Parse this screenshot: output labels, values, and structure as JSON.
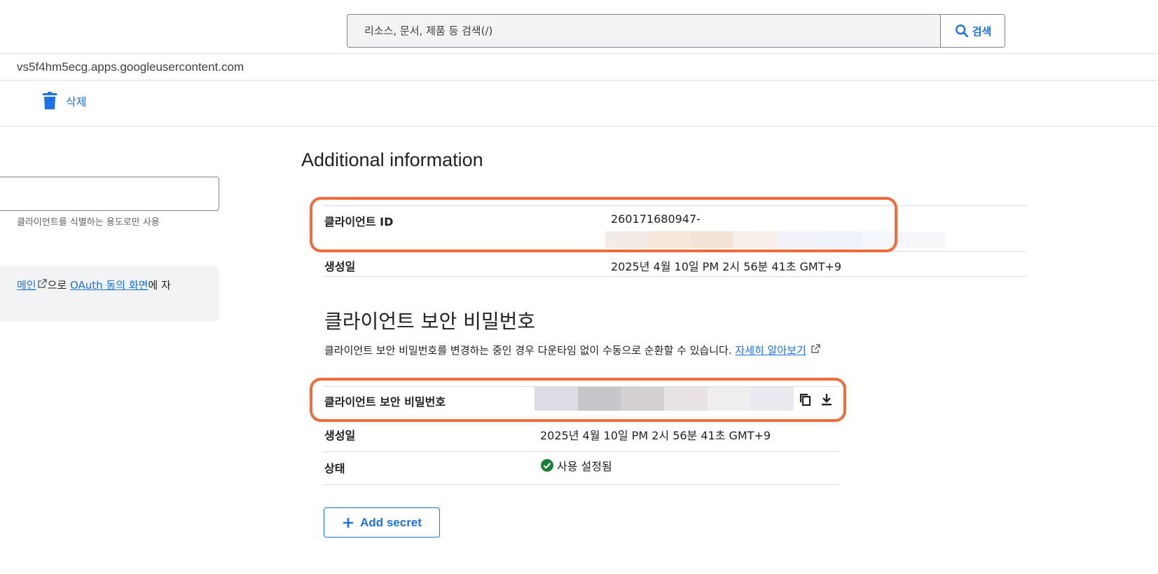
{
  "search": {
    "placeholder": "리소스, 문서, 제품 등 검색(/)",
    "button_label": "검색"
  },
  "client_url": "vs5f4hm5ecg.apps.googleusercontent.com",
  "actions": {
    "delete_label": "삭제"
  },
  "left_panel": {
    "help_text": "클라이언트를 식별하는 용도로만 사용",
    "note_link1": "메인",
    "note_text1": "으로 ",
    "note_link2": "OAuth 동의 화면",
    "note_text2": "에 자"
  },
  "additional_info": {
    "heading": "Additional information",
    "rows": [
      {
        "label": "클라이언트 ID",
        "value": "260171680947-"
      },
      {
        "label": "생성일",
        "value": "2025년 4월 10일 PM 2시 56분 41초 GMT+9"
      }
    ]
  },
  "client_secret": {
    "heading": "클라이언트 보안 비밀번호",
    "description": "클라이언트 보안 비밀번호를 변경하는 중인 경우 다운타임 없이 수동으로 순환할 수 있습니다. ",
    "learn_more": "자세히 알아보기",
    "rows": [
      {
        "label": "클라이언트 보안 비밀번호",
        "value": ""
      },
      {
        "label": "생성일",
        "value": "2025년 4월 10일 PM 2시 56분 41초 GMT+9"
      },
      {
        "label": "상태",
        "value": "사용 설정됨"
      }
    ],
    "add_button": "Add secret"
  },
  "icons": [
    "search-icon",
    "trash-icon",
    "external-link-icon",
    "copy-icon",
    "download-icon",
    "check-circle-icon",
    "plus-icon"
  ],
  "colors": {
    "accent": "#1a73e8",
    "highlight": "#f26b3a",
    "success": "#188038"
  }
}
